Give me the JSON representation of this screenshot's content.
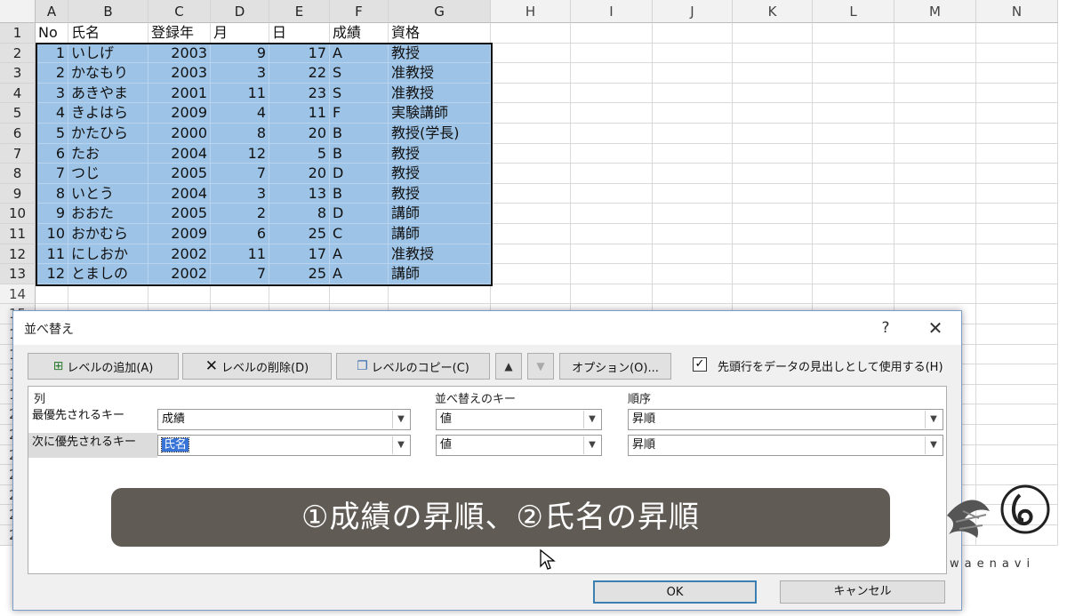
{
  "sheet": {
    "columns": [
      "A",
      "B",
      "C",
      "D",
      "E",
      "F",
      "G",
      "H",
      "I",
      "J",
      "K",
      "L",
      "M",
      "N"
    ],
    "rows": [
      "1",
      "2",
      "3",
      "4",
      "5",
      "6",
      "7",
      "8",
      "9",
      "10",
      "11",
      "12",
      "13",
      "14",
      "15",
      "16",
      "17",
      "18",
      "19",
      "20",
      "21",
      "22",
      "23",
      "24",
      "25",
      "26"
    ],
    "header_row": [
      "No",
      "氏名",
      "登録年",
      "月",
      "日",
      "成績",
      "資格"
    ],
    "data": [
      [
        "1",
        "いしげ",
        "2003",
        "9",
        "17",
        "A",
        "教授"
      ],
      [
        "2",
        "かなもり",
        "2003",
        "3",
        "22",
        "S",
        "准教授"
      ],
      [
        "3",
        "あきやま",
        "2001",
        "11",
        "23",
        "S",
        "准教授"
      ],
      [
        "4",
        "きよはら",
        "2009",
        "4",
        "11",
        "F",
        "実験講師"
      ],
      [
        "5",
        "かたひら",
        "2000",
        "8",
        "20",
        "B",
        "教授(学長)"
      ],
      [
        "6",
        "たお",
        "2004",
        "12",
        "5",
        "B",
        "教授"
      ],
      [
        "7",
        "つじ",
        "2005",
        "7",
        "20",
        "D",
        "教授"
      ],
      [
        "8",
        "いとう",
        "2004",
        "3",
        "13",
        "B",
        "教授"
      ],
      [
        "9",
        "おおた",
        "2005",
        "2",
        "8",
        "D",
        "講師"
      ],
      [
        "10",
        "おかむら",
        "2009",
        "6",
        "25",
        "C",
        "講師"
      ],
      [
        "11",
        "にしおか",
        "2002",
        "11",
        "17",
        "A",
        "准教授"
      ],
      [
        "12",
        "とましの",
        "2002",
        "7",
        "25",
        "A",
        "講師"
      ]
    ]
  },
  "dialog": {
    "title": "並べ替え",
    "help": "?",
    "close": "✕",
    "buttons": {
      "add_level": "レベルの追加(A)",
      "delete_level": "レベルの削除(D)",
      "copy_level": "レベルのコピー(C)",
      "move_up": "▲",
      "move_down": "▼",
      "options": "オプション(O)..."
    },
    "header_checkbox": {
      "label": "先頭行をデータの見出しとして使用する(H)",
      "checked": "✓"
    },
    "columns": {
      "col": "列",
      "sort_on": "並べ替えのキー",
      "order": "順序"
    },
    "levels": [
      {
        "label": "最優先されるキー",
        "column": "成績",
        "sort_on": "値",
        "order": "昇順"
      },
      {
        "label": "次に優先されるキー",
        "column": "氏名",
        "sort_on": "値",
        "order": "昇順"
      }
    ],
    "ok": "OK",
    "cancel": "キャンセル"
  },
  "caption": "①成績の昇順、②氏名の昇順",
  "logo": {
    "text": "waenavi"
  },
  "colors": {
    "selection": "#9dc3e6",
    "caption_bg": "#615b55",
    "ok_border": "#3c7fb1"
  }
}
